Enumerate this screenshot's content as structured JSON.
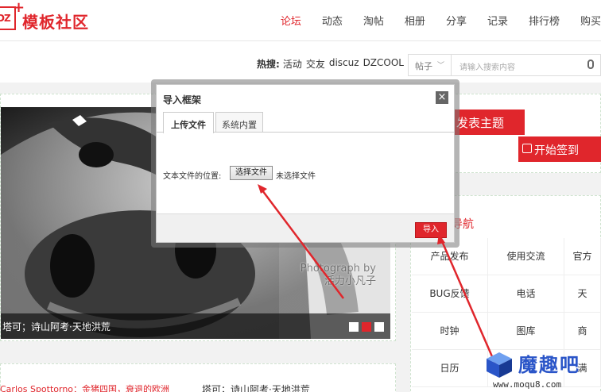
{
  "logo": {
    "mark": "DZ",
    "plus": "+",
    "text": "模板社区"
  },
  "nav": [
    {
      "label": "论坛",
      "active": true
    },
    {
      "label": "动态"
    },
    {
      "label": "淘帖"
    },
    {
      "label": "相册"
    },
    {
      "label": "分享"
    },
    {
      "label": "记录"
    },
    {
      "label": "排行榜"
    },
    {
      "label": "购买"
    }
  ],
  "search": {
    "hot_label": "热搜:",
    "hot_terms": [
      "活动",
      "交友",
      "discuz",
      "DZCOOL"
    ],
    "scope": "帖子",
    "placeholder": "请输入搜索内容"
  },
  "banner": {
    "credit_line1": "Photograph by",
    "credit_line2": "活力小凡子",
    "caption": "塔可；诗山阿考·天地洪荒"
  },
  "sidebar": {
    "post_button": "发表主题",
    "sign_button": "开始签到",
    "nav_title": "导航",
    "grid": [
      "产品发布",
      "使用交流",
      "官方",
      "BUG反馈",
      "电话",
      "天",
      "时钟",
      "图库",
      "商",
      "日历",
      "",
      "满"
    ]
  },
  "list": {
    "row_a": "Carlos Spottorno：金猪四国，衰退的欧洲",
    "row_b": "塔可；诗山阿考·天地洪荒"
  },
  "modal": {
    "title": "导入框架",
    "close": "×",
    "tabs": [
      "上传文件",
      "系统内置"
    ],
    "file_label": "文本文件的位置:",
    "file_button": "选择文件",
    "file_status": "未选择文件",
    "import_button": "导入"
  },
  "watermark": {
    "text": "魔趣吧",
    "url": "www.moqu8.com"
  },
  "colors": {
    "accent": "#e0262c",
    "watermark": "#2a55c8"
  }
}
